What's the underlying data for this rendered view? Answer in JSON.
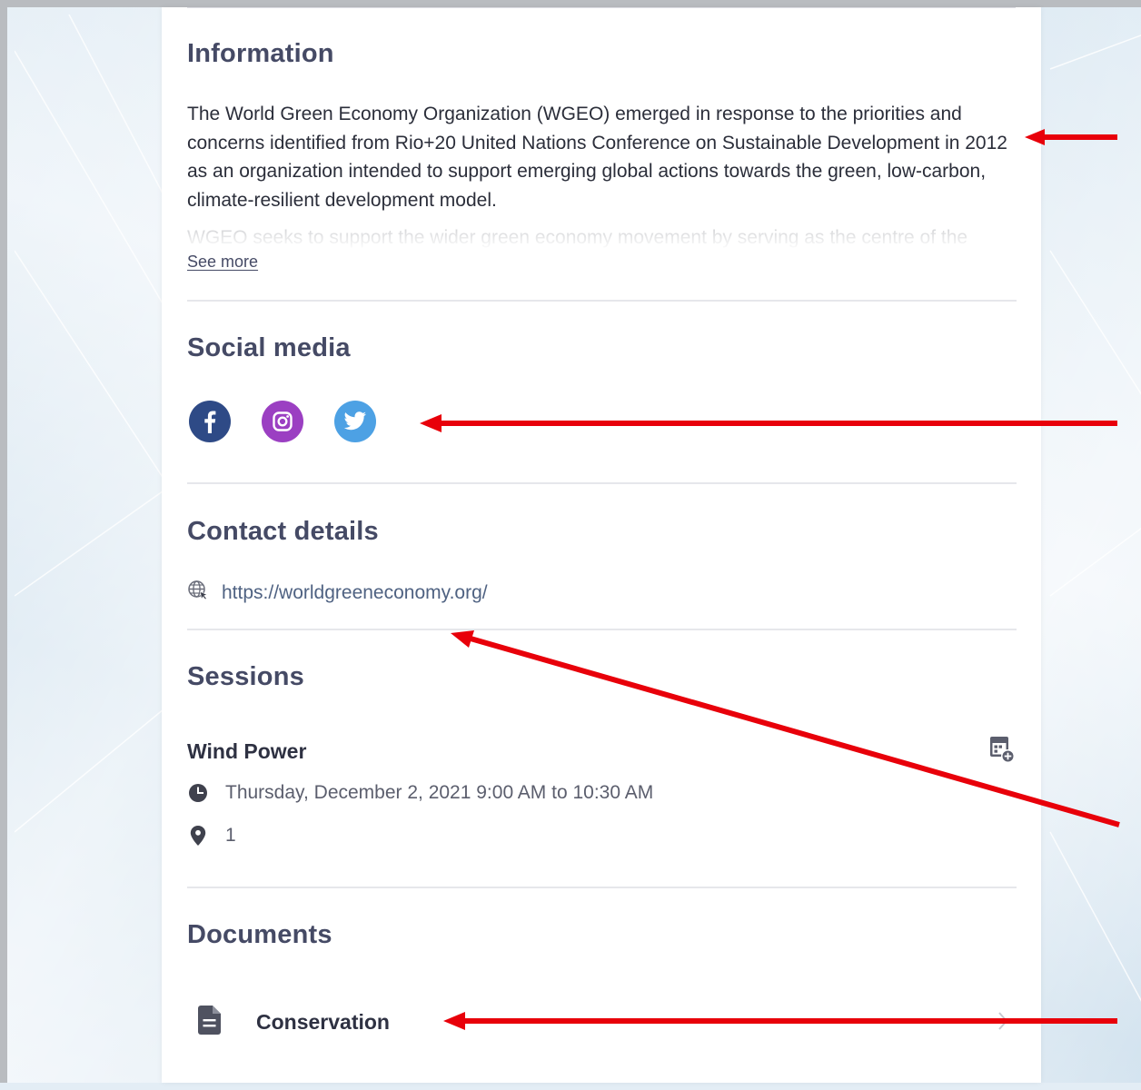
{
  "information": {
    "heading": "Information",
    "paragraph": "The World Green Economy Organization (WGEO) emerged in response to the priorities and concerns identified from Rio+20 United Nations Conference on Sustainable Development in 2012 as an organization intended to support emerging global actions towards the green, low-carbon, climate-resilient development model.",
    "faded_line": "WGEO seeks to support the wider green economy movement by serving as the centre of the",
    "see_more": "See more"
  },
  "social": {
    "heading": "Social media",
    "icons": [
      "facebook-icon",
      "instagram-icon",
      "twitter-icon"
    ],
    "colors": {
      "facebook": "#2e4a86",
      "instagram": "#9b3fc2",
      "twitter": "#4da1e4"
    }
  },
  "contact": {
    "heading": "Contact details",
    "website": "https://worldgreeneconomy.org/"
  },
  "sessions": {
    "heading": "Sessions",
    "items": [
      {
        "title": "Wind Power",
        "datetime": "Thursday, December 2, 2021 9:00 AM to 10:30 AM",
        "location": "1"
      }
    ]
  },
  "documents": {
    "heading": "Documents",
    "items": [
      {
        "name": "Conservation"
      }
    ]
  },
  "annotation_color": "#e8000a"
}
